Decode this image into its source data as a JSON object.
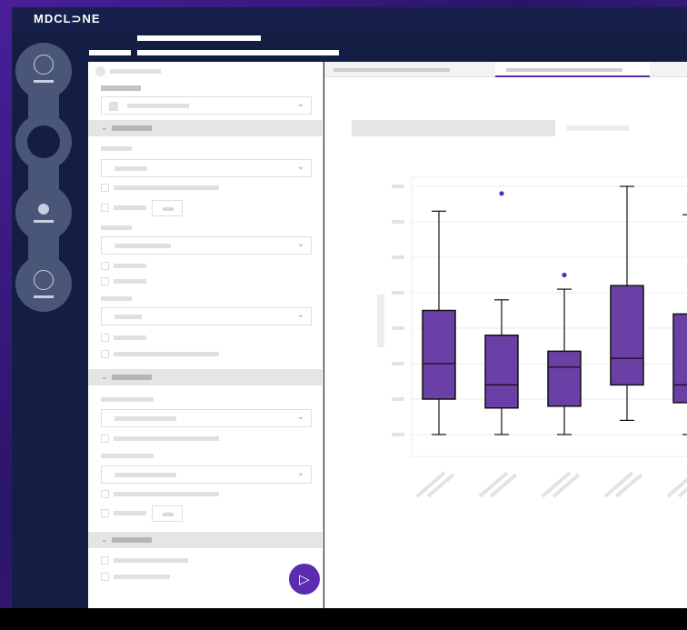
{
  "app": {
    "logo_text": "MDCL⊃NE",
    "accent_color": "#5b2bb0",
    "nav_color": "#141e44"
  },
  "nav": {
    "items": [
      {
        "name": "nav-item-1",
        "icon": "ring-icon"
      },
      {
        "name": "nav-item-2",
        "icon": "filled-circle-icon"
      },
      {
        "name": "nav-item-3",
        "icon": "dot-icon"
      },
      {
        "name": "nav-item-4",
        "icon": "ring-icon"
      }
    ]
  },
  "sidebar": {
    "run_icon": "play-icon"
  },
  "chart_data": {
    "type": "box",
    "categories": [
      "",
      "",
      "",
      "",
      ""
    ],
    "ylim": [
      0,
      7
    ],
    "grid": true,
    "box_color": "#6a3fa6",
    "outlier_color": "#5b2bb0",
    "boxes": [
      {
        "whisker_low": 0,
        "q1": 1.0,
        "median": 2.0,
        "q3": 3.5,
        "whisker_high": 6.3,
        "outliers": []
      },
      {
        "whisker_low": 0,
        "q1": 0.75,
        "median": 1.4,
        "q3": 2.8,
        "whisker_high": 3.8,
        "outliers": [
          6.8
        ]
      },
      {
        "whisker_low": 0,
        "q1": 0.8,
        "median": 1.9,
        "q3": 2.35,
        "whisker_high": 4.1,
        "outliers": [
          4.5
        ]
      },
      {
        "whisker_low": 0.4,
        "q1": 1.4,
        "median": 2.15,
        "q3": 4.2,
        "whisker_high": 7.0,
        "outliers": []
      },
      {
        "whisker_low": 0,
        "q1": 0.9,
        "median": 1.4,
        "q3": 3.4,
        "whisker_high": 6.2,
        "outliers": []
      }
    ]
  }
}
